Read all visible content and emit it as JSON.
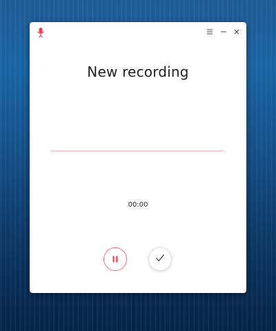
{
  "window": {
    "title": "New recording",
    "app_icon": "microphone-icon",
    "controls": {
      "menu_icon": "hamburger-menu-icon",
      "minimize_icon": "minimize-icon",
      "close_icon": "close-icon"
    }
  },
  "recording": {
    "elapsed": "00:00",
    "waveform_color": "#f4b4b8"
  },
  "actions": {
    "pause_icon": "pause-icon",
    "finish_icon": "checkmark-icon"
  },
  "colors": {
    "accent": "#f0404f",
    "desktop_background": "#0a5ea6"
  }
}
